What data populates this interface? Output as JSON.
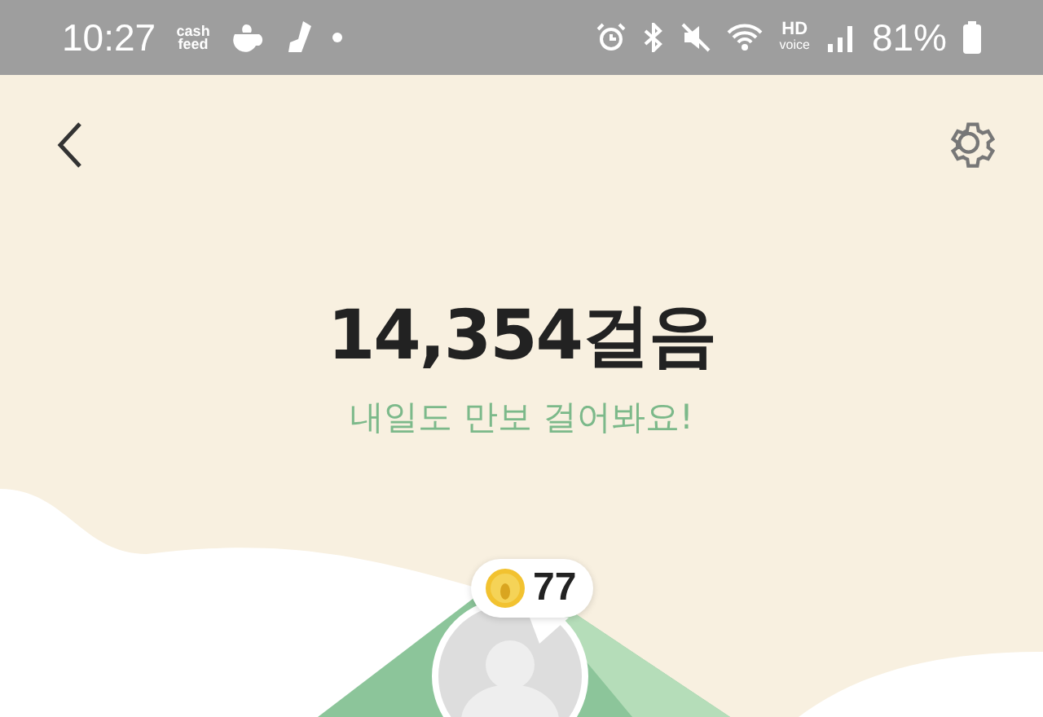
{
  "status_bar": {
    "time": "10:27",
    "app_logo": "cash feed",
    "hd_label": "HD",
    "voice_label": "voice",
    "battery": "81%"
  },
  "steps": {
    "count": "14,354걸음",
    "message": "내일도 만보 걸어봐요!"
  },
  "reward": {
    "coins": "77"
  }
}
